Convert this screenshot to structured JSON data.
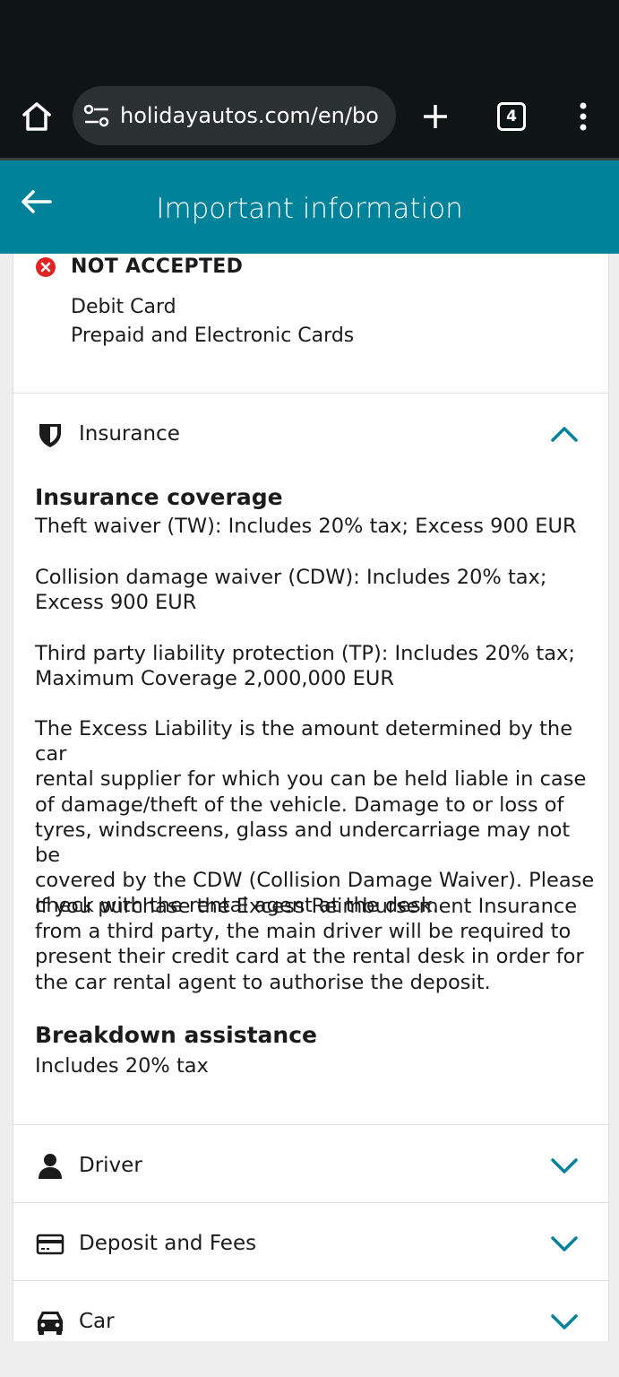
{
  "browser": {
    "url": "holidayautos.com/en/bo",
    "tab_count": "4",
    "icons": {
      "home": "home-icon",
      "site_info": "tune-icon",
      "new_tab": "plus-icon",
      "menu": "more-vertical-icon"
    }
  },
  "header": {
    "title": "Important information",
    "back_icon": "arrow-left-icon",
    "background": "#00839a"
  },
  "payment": {
    "not_accepted_label": "NOT ACCEPTED",
    "not_accepted_items": [
      "Debit Card",
      "Prepaid and Electronic Cards"
    ],
    "status_color": "#e02424"
  },
  "sections": {
    "insurance": {
      "label": "Insurance",
      "icon": "shield-icon",
      "expanded": true,
      "coverage_heading": "Insurance coverage",
      "paragraphs": [
        "Theft waiver (TW): Includes 20% tax; Excess 900 EUR",
        "Collision damage waiver (CDW): Includes 20% tax;\nExcess 900 EUR",
        "Third party liability protection (TP): Includes 20% tax;\nMaximum Coverage 2,000,000 EUR",
        "The Excess Liability is the amount determined by the car\nrental supplier for which you can be held liable in case\nof damage/theft of the vehicle. Damage to or loss of\ntyres, windscreens, glass and undercarriage may not be\ncovered by the CDW (Collision Damage Waiver). Please\ncheck with the rental agent at the desk.",
        "If you purchase the Excess Reimbursement Insurance\nfrom a third party, the main driver will be required to\npresent their credit card at the rental desk in order for\nthe car rental agent to authorise the deposit."
      ],
      "breakdown_heading": "Breakdown assistance",
      "breakdown_text": "Includes 20% tax"
    },
    "driver": {
      "label": "Driver",
      "icon": "person-icon",
      "expanded": false
    },
    "deposit": {
      "label": "Deposit and Fees",
      "icon": "credit-card-icon",
      "expanded": false
    },
    "car": {
      "label": "Car",
      "icon": "car-icon",
      "expanded": false
    }
  },
  "accent_color": "#00839a"
}
